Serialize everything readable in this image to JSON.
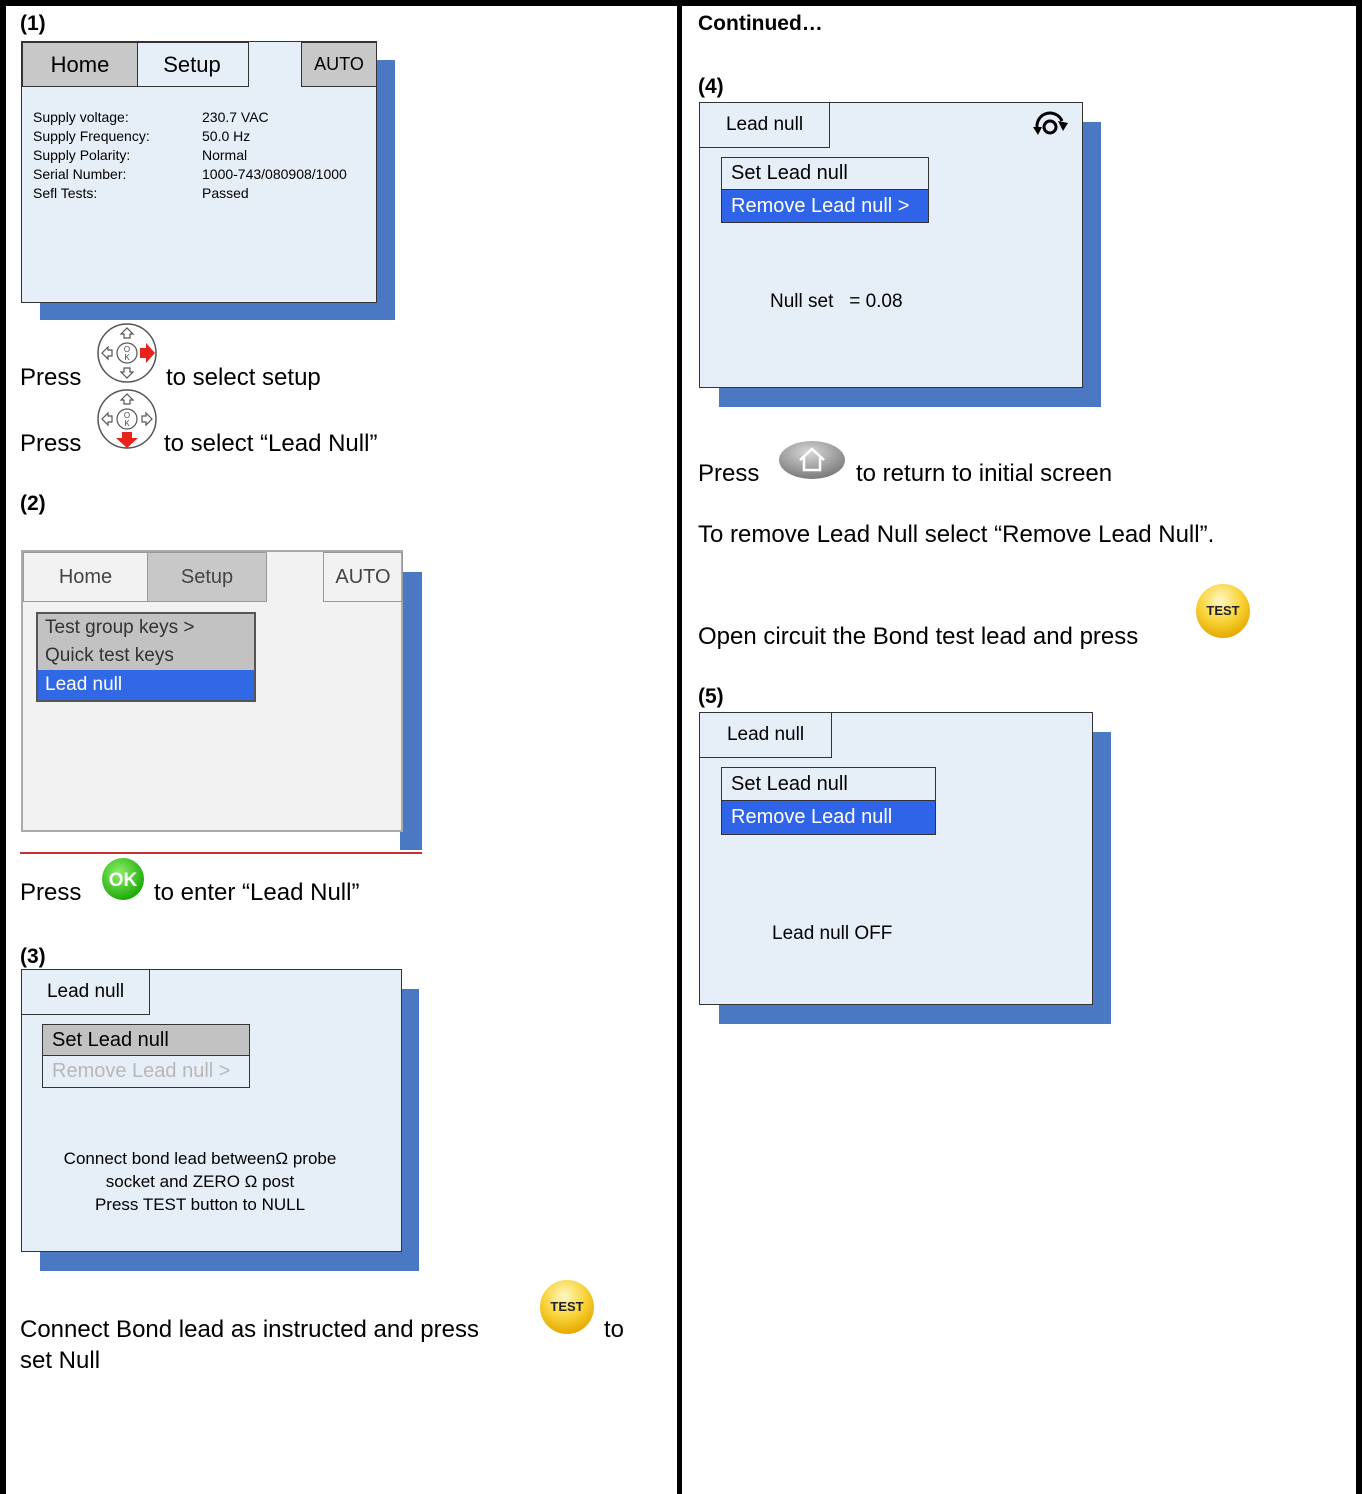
{
  "left": {
    "s1": {
      "label": "(1)",
      "tabs": [
        "Home",
        "Setup",
        "AUTO"
      ],
      "info_labels": [
        "Supply voltage:",
        "Supply Frequency:",
        "Supply Polarity:",
        "Serial Number:",
        "Sefl Tests:"
      ],
      "info_values": [
        "230.7 VAC",
        "50.0 Hz",
        "Normal",
        "1000-743/080908/1000",
        "Passed"
      ]
    },
    "step1a": {
      "press": "Press",
      "text": "to select setup"
    },
    "step1b": {
      "press": "Press",
      "text": "to select “Lead Null”"
    },
    "s2": {
      "label": "(2)",
      "tabs": [
        "Home",
        "Setup",
        "AUTO"
      ],
      "menu": [
        "Test group keys >",
        "Quick test keys",
        "Lead null"
      ]
    },
    "step2": {
      "press": "Press",
      "text": "to enter “Lead Null”"
    },
    "s3": {
      "label": "(3)",
      "tab": "Lead null",
      "menu": [
        "Set Lead null",
        "Remove Lead null >"
      ],
      "message": [
        "Connect bond lead betweenΩ probe",
        "socket and ZERO Ω post",
        "Press TEST button to NULL"
      ]
    },
    "step3": {
      "text": "Connect Bond lead as instructed and press",
      "to": "to",
      "line2": "set Null"
    }
  },
  "right": {
    "header": "Continued…",
    "s4": {
      "label": "(4)",
      "tab": "Lead null",
      "menu": [
        "Set Lead null",
        "Remove Lead null >"
      ],
      "status": "Null set   = 0.08"
    },
    "step4": {
      "press": "Press",
      "text": "to return to initial screen"
    },
    "remove_text": "To remove Lead Null select “Remove Lead Null”.",
    "open_text": "Open circuit the Bond test lead and press",
    "s5": {
      "label": "(5)",
      "tab": "Lead null",
      "menu": [
        "Set Lead null",
        "Remove Lead null"
      ],
      "status": "Lead null OFF"
    }
  },
  "buttons": {
    "test": "TEST",
    "ok": "OK"
  },
  "colors": {
    "selection": "#2f64e8",
    "shadow": "#4a78c2",
    "screen": "#e6eef8",
    "test": "#f6c400",
    "ok": "#2ec40e"
  }
}
